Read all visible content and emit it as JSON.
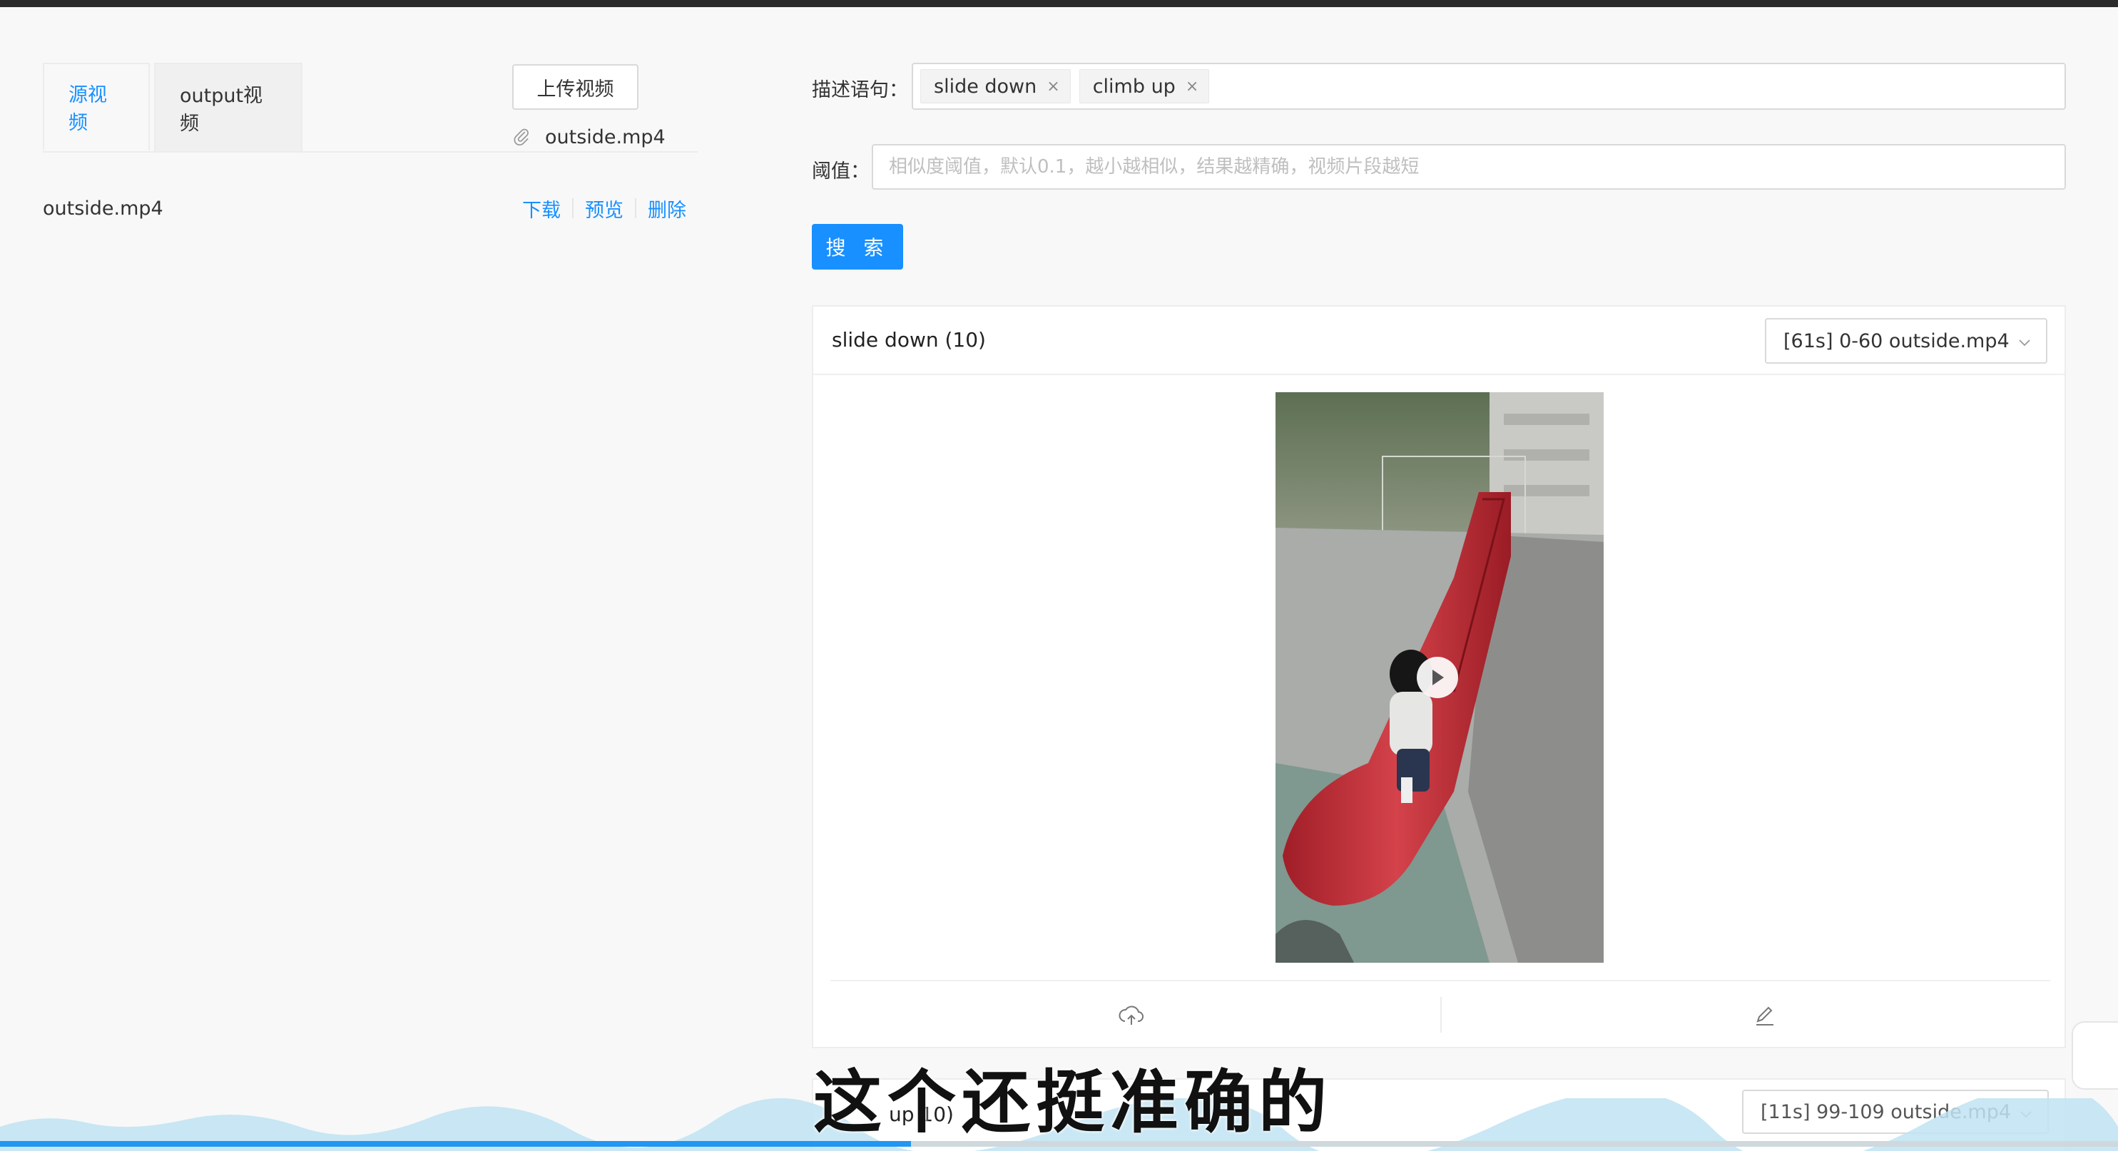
{
  "left_panel": {
    "tabs": [
      {
        "label": "源视频",
        "active": true
      },
      {
        "label": "output视频",
        "active": false
      }
    ],
    "upload_button": "上传视频",
    "attachment_name": "outside.mp4",
    "files": [
      {
        "name": "outside.mp4",
        "actions": [
          "下载",
          "预览",
          "删除"
        ]
      }
    ]
  },
  "form": {
    "desc_label": "描述语句：",
    "tags": [
      "slide down",
      "climb up"
    ],
    "tag_close_glyph": "×",
    "threshold_label": "阈值：",
    "threshold_value": "",
    "threshold_placeholder": "相似度阈值，默认0.1，越小越相似，结果越精确，视频片段越短",
    "search_button": "搜 索"
  },
  "results": [
    {
      "title": "slide down (10)",
      "selected_clip": "[61s] 0-60 outside.mp4",
      "icons": [
        "cloud-upload-icon",
        "edit-icon"
      ]
    },
    {
      "title": "up 10)",
      "selected_clip": "[11s] 99-109 outside.mp4"
    }
  ],
  "overlay": {
    "subtitle": "这个还挺准确的",
    "progress": 0.43
  },
  "colors": {
    "accent": "#1890ff",
    "slide_red": "#c8303a",
    "background": "#f8f8f9"
  }
}
